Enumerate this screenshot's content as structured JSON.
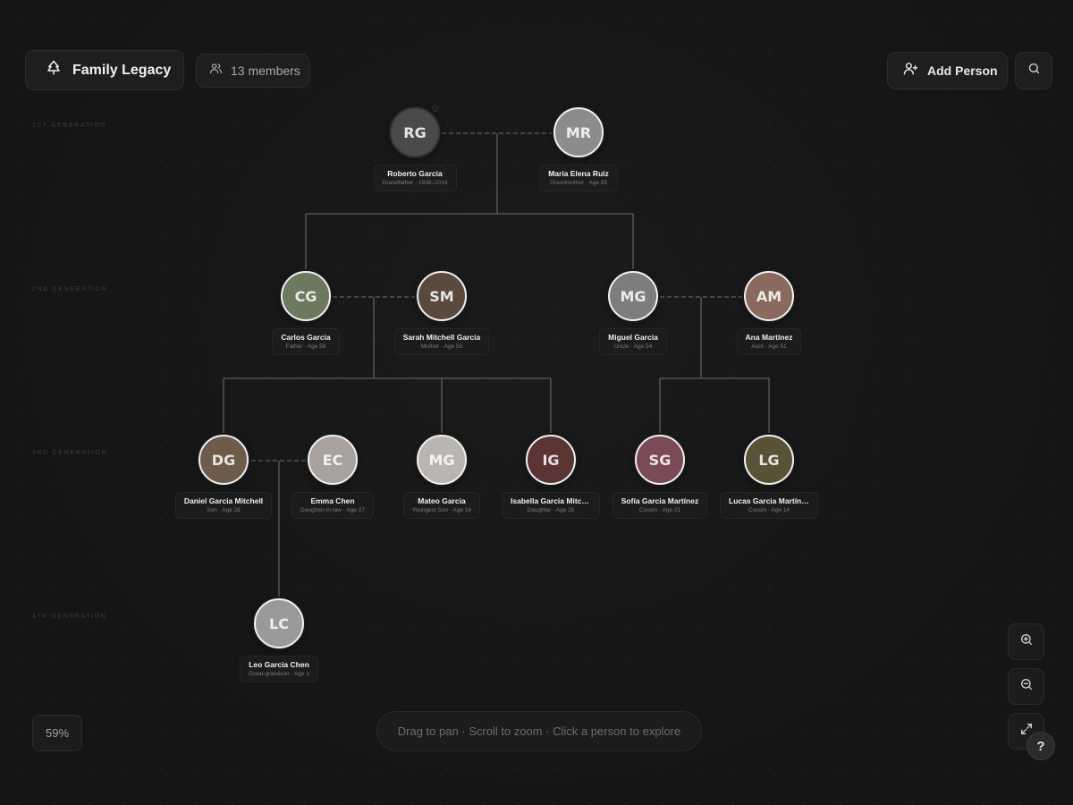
{
  "header": {
    "app_title": "Family Legacy",
    "members_label": "13 members",
    "add_person_label": "Add Person"
  },
  "generations": [
    "1st Generation",
    "2nd Generation",
    "3rd Generation",
    "4th Generation"
  ],
  "people": [
    {
      "id": "roberto",
      "name": "Roberto Garcia",
      "meta": "Grandfather · 1938–2019",
      "initials": "RG",
      "color": "#4a4a4a",
      "deceased": true
    },
    {
      "id": "maria",
      "name": "María Elena Ruiz",
      "meta": "Grandmother · Age 85",
      "initials": "MR",
      "color": "#8c8c8c"
    },
    {
      "id": "carlos",
      "name": "Carlos Garcia",
      "meta": "Father · Age 58",
      "initials": "CG",
      "color": "#6b7a5e"
    },
    {
      "id": "sarah",
      "name": "Sarah Mitchell Garcia",
      "meta": "Mother · Age 56",
      "initials": "SM",
      "color": "#5a4a3e"
    },
    {
      "id": "miguel",
      "name": "Miguel Garcia",
      "meta": "Uncle · Age 54",
      "initials": "MG",
      "color": "#7d7d7d"
    },
    {
      "id": "ana",
      "name": "Ana Martínez",
      "meta": "Aunt · Age 51",
      "initials": "AM",
      "color": "#8a6a5e"
    },
    {
      "id": "daniel",
      "name": "Daniel Garcia Mitchell",
      "meta": "Son · Age 28",
      "initials": "DG",
      "color": "#6e5c4a"
    },
    {
      "id": "emma",
      "name": "Emma Chen",
      "meta": "Daughter-in-law · Age 27",
      "initials": "EC",
      "color": "#a8a29e"
    },
    {
      "id": "mateo",
      "name": "Mateo Garcia",
      "meta": "Youngest Son · Age 16",
      "initials": "MG",
      "color": "#b9b5b0"
    },
    {
      "id": "isabella",
      "name": "Isabella Garcia Mitchell",
      "meta": "Daughter · Age 25",
      "initials": "IG",
      "color": "#5b3434"
    },
    {
      "id": "sofia",
      "name": "Sofía Garcia Martínez",
      "meta": "Cousin · Age 21",
      "initials": "SG",
      "color": "#7a4a56"
    },
    {
      "id": "lucas",
      "name": "Lucas Garcia Martínez",
      "meta": "Cousin · Age 14",
      "initials": "LG",
      "color": "#5a5236"
    },
    {
      "id": "leo",
      "name": "Leo Garcia Chen",
      "meta": "Great-grandson · Age 1",
      "initials": "LC",
      "color": "#9a9a9a"
    }
  ],
  "controls": {
    "zoom_level": "59%",
    "hint": "Drag to pan · Scroll to zoom · Click a person to explore",
    "help_label": "?"
  }
}
